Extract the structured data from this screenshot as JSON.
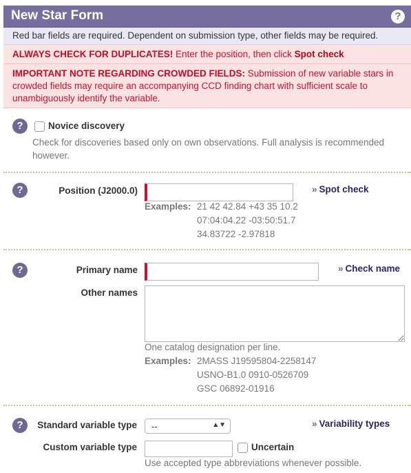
{
  "form": {
    "title": "New Star Form",
    "help_icon": "?",
    "info": "Red bar fields are required. Dependent on submission type, other fields may be required.",
    "dup_warning": {
      "bold": "ALWAYS CHECK FOR DUPLICATES!",
      "text": " Enter the position, then click ",
      "link": "Spot check"
    },
    "crowded_note": {
      "bold": "IMPORTANT NOTE REGARDING CROWDED FIELDS:",
      "text": " Submission of new variable stars in crowded fields may require an accompanying CCD finding chart with sufficient scale to unambiguously identify the variable."
    }
  },
  "novice": {
    "label": "Novice discovery",
    "checked": false,
    "help": "Check for discoveries based only on own observations. Full analysis is recommended however."
  },
  "position": {
    "label": "Position (J2000.0)",
    "value": "",
    "spot_check": "Spot check",
    "examples_label": "Examples:",
    "examples": [
      "21 42 42.84 +43 35 10.2",
      "07:04:04.22 -03:50:51.7",
      "34.83722 -2.97818"
    ]
  },
  "names": {
    "primary_label": "Primary name",
    "primary_value": "",
    "check_name": "Check name",
    "other_label": "Other names",
    "other_value": "",
    "hint": "One catalog designation per line.",
    "examples_label": "Examples:",
    "examples": [
      "2MASS J19595804-2258147",
      "USNO-B1.0 0910-0526709",
      "GSC 06892-01916"
    ]
  },
  "variability": {
    "std_label": "Standard variable type",
    "std_value": "--",
    "types_link": "Variability types",
    "custom_label": "Custom variable type",
    "custom_value": "",
    "uncertain_label": "Uncertain",
    "uncertain_checked": false,
    "hint": "Use accepted type abbreviations whenever possible."
  },
  "icons": {
    "help": "question-circle-icon",
    "chevron": "double-chevron-right-icon",
    "select_arrows": "up-down-arrows-icon"
  },
  "colors": {
    "title_bg": "#776d9f",
    "info_bg": "#ebe8f6",
    "warning_bg": "#fbe3e3",
    "warning_text": "#d0102d",
    "required_bar": "#d0102d",
    "help_icon": "#6f6794"
  }
}
